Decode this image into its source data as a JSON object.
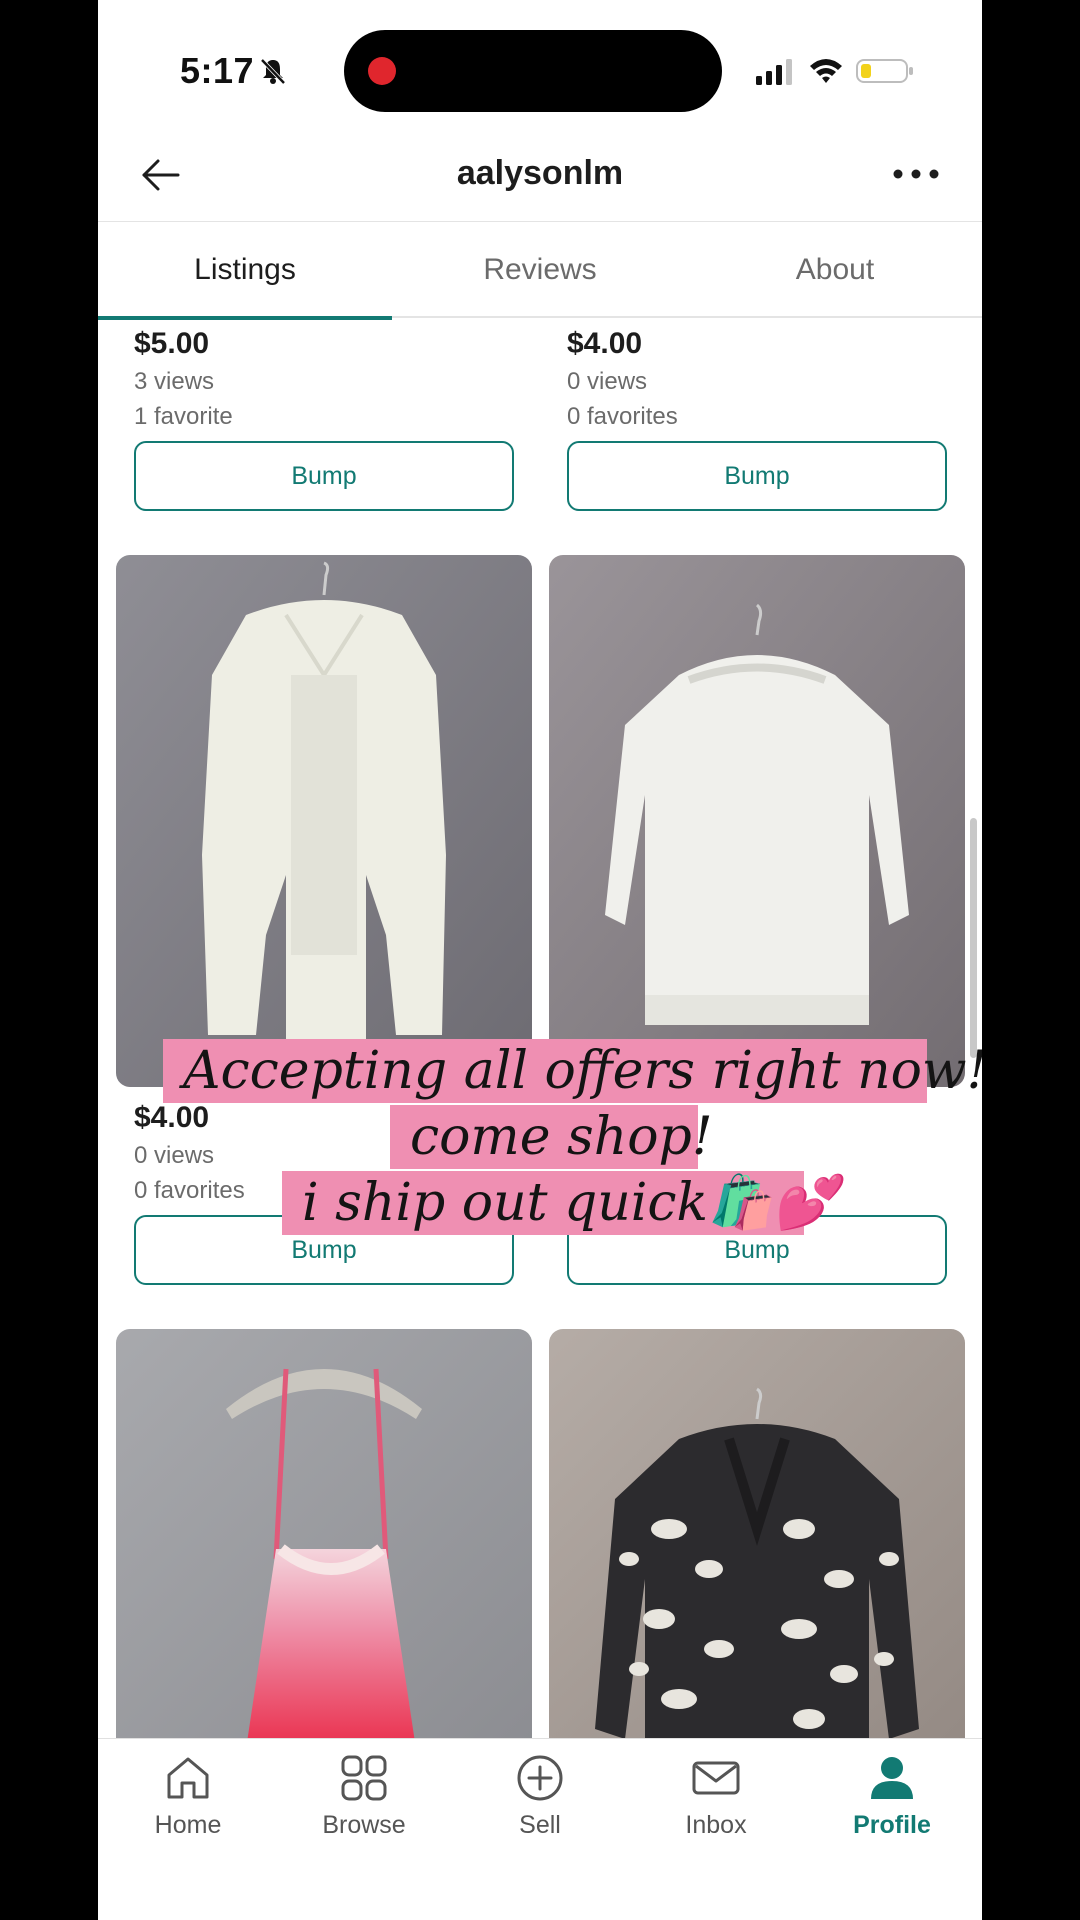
{
  "status_bar": {
    "time": "5:17"
  },
  "header": {
    "title": "aalysonlm"
  },
  "tabs": [
    {
      "label": "Listings",
      "active": true
    },
    {
      "label": "Reviews",
      "active": false
    },
    {
      "label": "About",
      "active": false
    }
  ],
  "listings": [
    {
      "price": "$5.00",
      "views": "3 views",
      "favorites": "1 favorite",
      "bump_label": "Bump"
    },
    {
      "price": "$4.00",
      "views": "0 views",
      "favorites": "0 favorites",
      "bump_label": "Bump"
    },
    {
      "price": "$4.00",
      "views": "0 views",
      "favorites": "0 favorites",
      "bump_label": "Bump",
      "photo": "white-cardigan"
    },
    {
      "price": "",
      "views": "",
      "favorites": "",
      "bump_label": "Bump",
      "photo": "white-blouse"
    },
    {
      "photo": "pink-lace-slip-dress"
    },
    {
      "photo": "leopard-cardigan"
    }
  ],
  "overlay": {
    "lines": [
      "Accepting all offers right now!!",
      "come shop!",
      "i ship out quick🛍️💕"
    ]
  },
  "bottom_nav": [
    {
      "label": "Home",
      "icon": "home-icon",
      "active": false
    },
    {
      "label": "Browse",
      "icon": "grid-icon",
      "active": false
    },
    {
      "label": "Sell",
      "icon": "plus-circle-icon",
      "active": false
    },
    {
      "label": "Inbox",
      "icon": "mail-icon",
      "active": false
    },
    {
      "label": "Profile",
      "icon": "profile-icon",
      "active": true
    }
  ],
  "colors": {
    "accent": "#127a73",
    "overlay_bg": "#ef8fb2",
    "tab_indicator": "#127a73"
  }
}
